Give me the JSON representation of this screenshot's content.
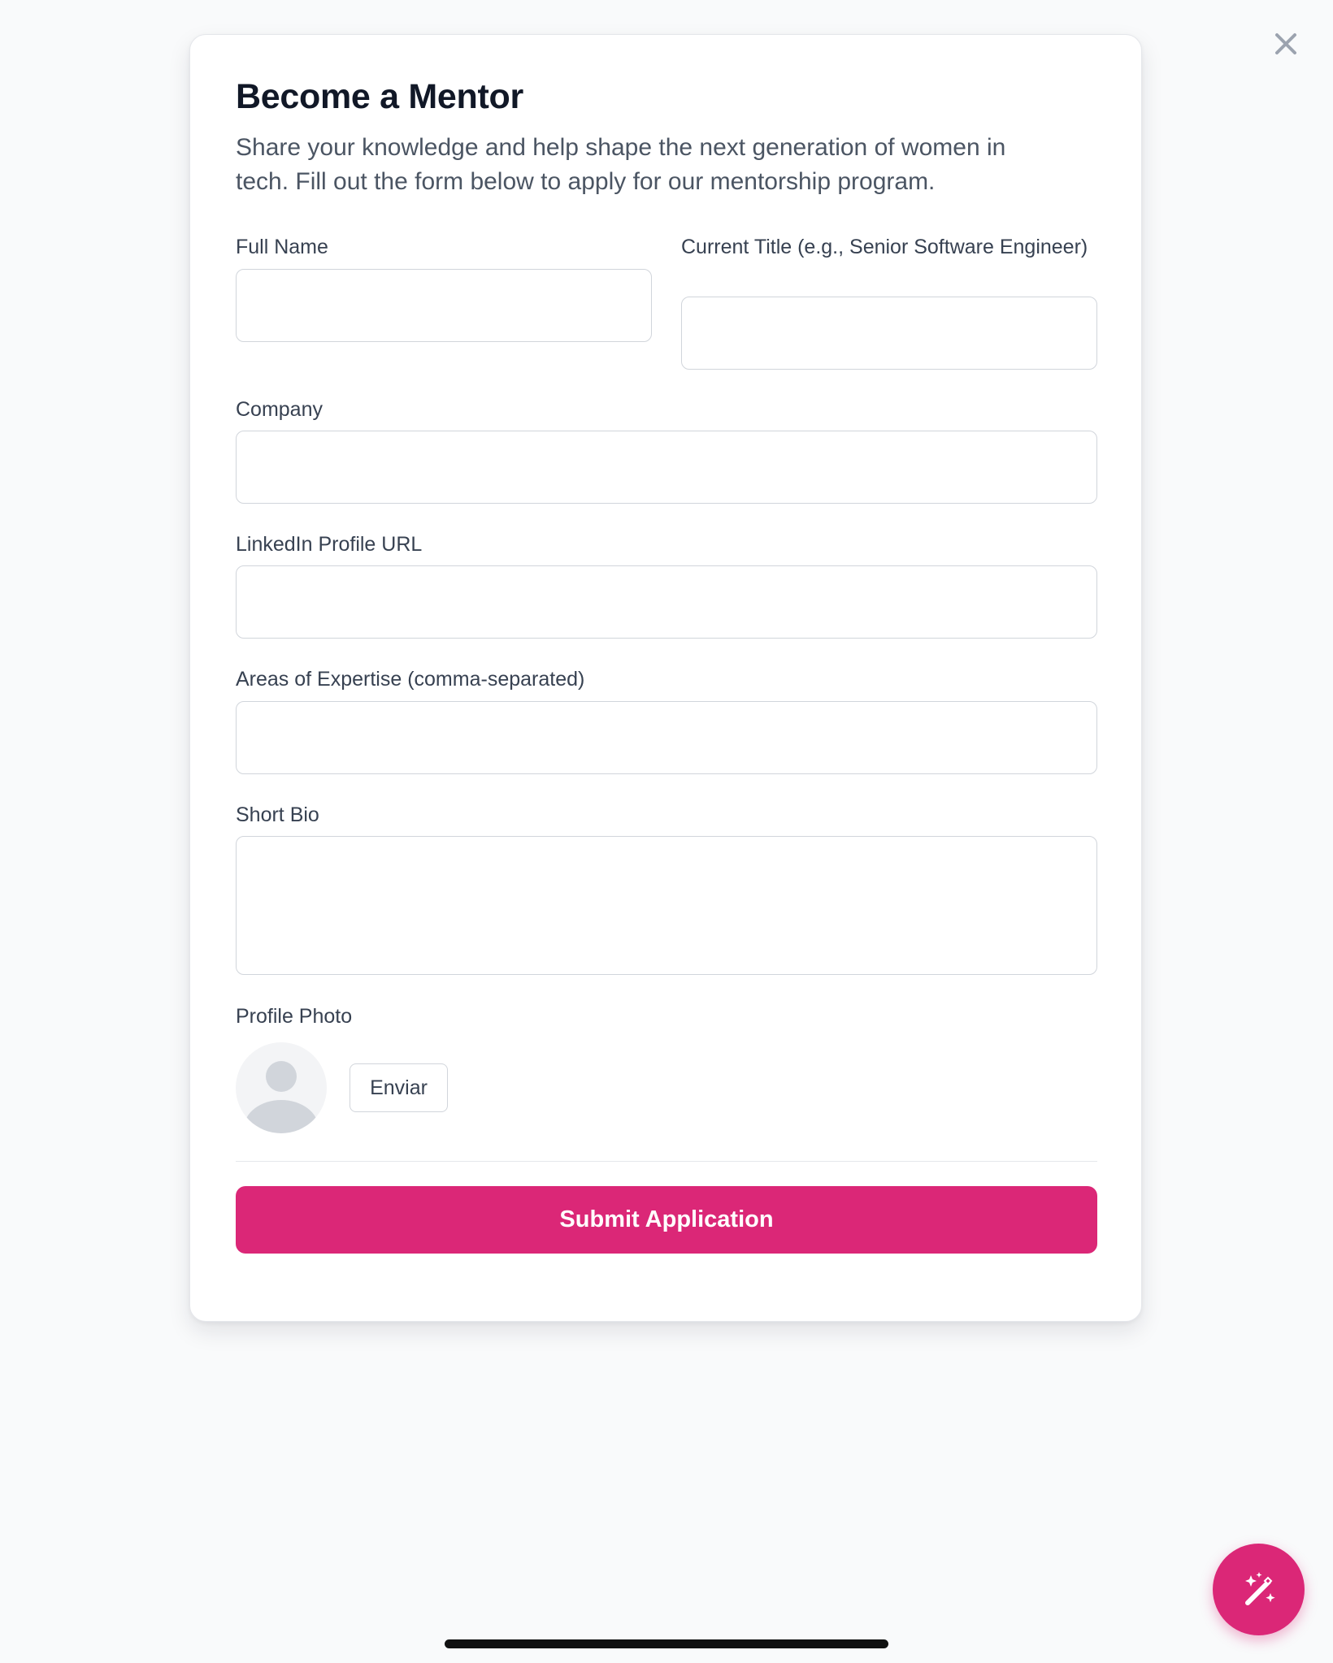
{
  "modal": {
    "title": "Become a Mentor",
    "subtitle": "Share your knowledge and help shape the next generation of women in tech. Fill out the form below to apply for our mentorship program."
  },
  "form": {
    "full_name": {
      "label": "Full Name",
      "value": ""
    },
    "current_title": {
      "label": "Current Title (e.g., Senior Software Engineer)",
      "value": ""
    },
    "company": {
      "label": "Company",
      "value": ""
    },
    "linkedin": {
      "label": "LinkedIn Profile URL",
      "value": ""
    },
    "expertise": {
      "label": "Areas of Expertise (comma-separated)",
      "value": ""
    },
    "bio": {
      "label": "Short Bio",
      "value": ""
    },
    "photo": {
      "label": "Profile Photo",
      "upload_label": "Enviar"
    },
    "submit_label": "Submit Application"
  },
  "icons": {
    "close": "close-icon",
    "avatar": "user-placeholder-icon",
    "fab": "magic-wand-icon"
  },
  "colors": {
    "accent": "#db2777",
    "background": "#f9fafb",
    "border": "#d1d5db",
    "title": "#111827",
    "body_text": "#4b5563"
  }
}
